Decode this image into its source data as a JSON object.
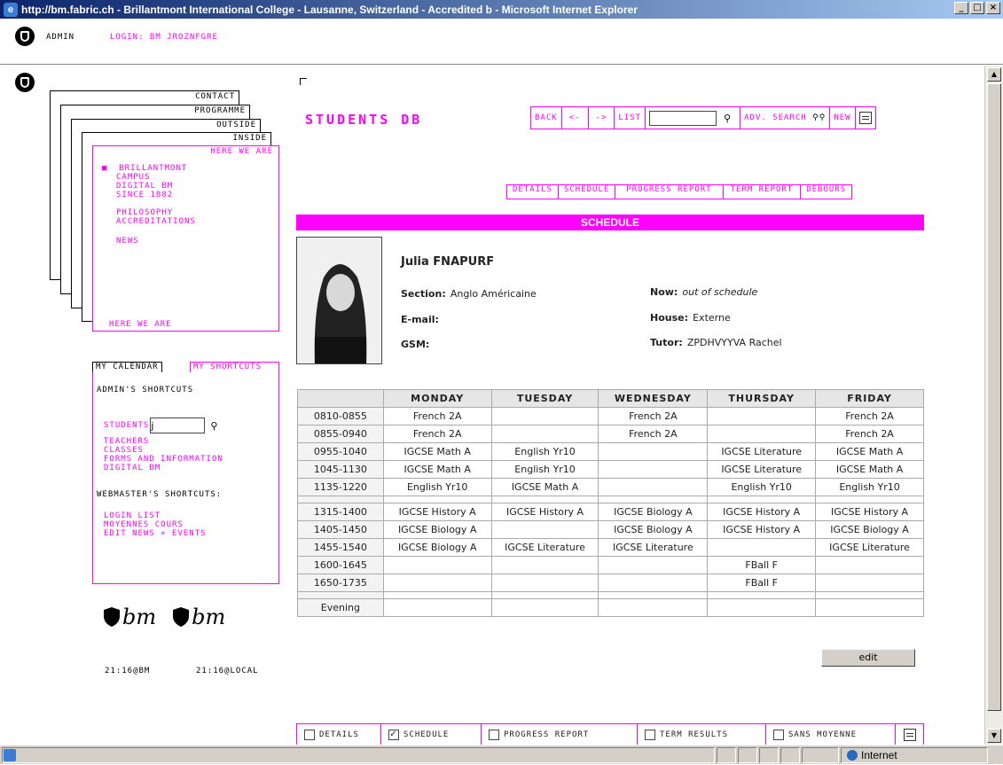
{
  "window": {
    "title": "http://bm.fabric.ch - Brillantmont International College - Lausanne, Switzerland - Accredited b - Microsoft Internet Explorer"
  },
  "topbar": {
    "admin": "ADMIN",
    "login": "LOGIN: BM JROZNFGRE"
  },
  "stack": {
    "tabs": [
      "CONTACT",
      "PROGRAMME",
      "OUTSIDE",
      "INSIDE"
    ],
    "inner_title": "HERE WE ARE",
    "items": [
      "BRILLANTMONT",
      "CAMPUS",
      "DIGITAL BM",
      "SINCE 1882",
      "PHILOSOPHY",
      "ACCREDITATIONS",
      "NEWS"
    ],
    "footer": "HERE WE ARE"
  },
  "shortcuts": {
    "tab_calendar": "MY CALENDAR",
    "tab_shortcuts": "MY SHORTCUTS",
    "admin_title": "ADMIN'S SHORTCUTS",
    "students_label": "STUDENTS",
    "students_value": "j",
    "links": [
      "TEACHERS",
      "CLASSES",
      "FORMS AND INFORMATION",
      "DIGITAL BM"
    ],
    "webmaster_title": "WEBMASTER'S SHORTCUTS:",
    "web_links": [
      "LOGIN LIST",
      "MOYENNES COURS",
      "EDIT NEWS + EVENTS"
    ]
  },
  "clocks": {
    "logo_text": "bm",
    "bm": "21:16@BM",
    "local": "21:16@LOCAL"
  },
  "header": {
    "title": "STUDENTS DB",
    "nav": [
      "BACK",
      "<-",
      "->",
      "LIST"
    ],
    "search_value": "",
    "adv": "ADV. SEARCH",
    "new": "NEW"
  },
  "tabs": [
    "DETAILS",
    "SCHEDULE",
    "PROGRESS REPORT",
    "TERM REPORT",
    "DEBOURS"
  ],
  "section_title": "SCHEDULE",
  "student": {
    "name": "Julia FNAPURF",
    "section_label": "Section:",
    "section": "Anglo Américaine",
    "email_label": "E-mail:",
    "email": "",
    "gsm_label": "GSM:",
    "gsm": "",
    "now_label": "Now:",
    "now": "out of schedule",
    "house_label": "House:",
    "house": "Externe",
    "tutor_label": "Tutor:",
    "tutor": "ZPDHVYYVA Rachel"
  },
  "schedule": {
    "days": [
      "MONDAY",
      "TUESDAY",
      "WEDNESDAY",
      "THURSDAY",
      "FRIDAY"
    ],
    "rows": [
      {
        "time": "0810-0855",
        "cells": [
          "French 2A",
          "",
          "French 2A",
          "",
          "French 2A"
        ]
      },
      {
        "time": "0855-0940",
        "cells": [
          "French 2A",
          "",
          "French 2A",
          "",
          "French 2A"
        ]
      },
      {
        "time": "0955-1040",
        "cells": [
          "IGCSE Math A",
          "English Yr10",
          "",
          "IGCSE Literature",
          "IGCSE Math A"
        ]
      },
      {
        "time": "1045-1130",
        "cells": [
          "IGCSE Math A",
          "English Yr10",
          "",
          "IGCSE Literature",
          "IGCSE Math A"
        ]
      },
      {
        "time": "1135-1220",
        "cells": [
          "English Yr10",
          "IGCSE Math A",
          "",
          "English Yr10",
          "English Yr10"
        ]
      },
      {
        "time": "",
        "cells": [
          "",
          "",
          "",
          "",
          ""
        ]
      },
      {
        "time": "1315-1400",
        "cells": [
          "IGCSE History A",
          "IGCSE History A",
          "IGCSE Biology A",
          "IGCSE History A",
          "IGCSE History A"
        ]
      },
      {
        "time": "1405-1450",
        "cells": [
          "IGCSE Biology A",
          "",
          "IGCSE Biology A",
          "IGCSE History A",
          "IGCSE Biology A"
        ]
      },
      {
        "time": "1455-1540",
        "cells": [
          "IGCSE Biology A",
          "IGCSE Literature",
          "IGCSE Literature",
          "",
          "IGCSE Literature"
        ]
      },
      {
        "time": "1600-1645",
        "cells": [
          "",
          "",
          "",
          "FBall F",
          ""
        ]
      },
      {
        "time": "1650-1735",
        "cells": [
          "",
          "",
          "",
          "FBall F",
          ""
        ]
      },
      {
        "time": "",
        "cells": [
          "",
          "",
          "",
          "",
          ""
        ]
      },
      {
        "time": "Evening",
        "cells": [
          "",
          "",
          "",
          "",
          ""
        ]
      }
    ],
    "edit": "edit"
  },
  "bottom": {
    "items": [
      {
        "label": "DETAILS",
        "checked": false
      },
      {
        "label": "SCHEDULE",
        "checked": true
      },
      {
        "label": "PROGRESS REPORT",
        "checked": false
      },
      {
        "label": "TERM RESULTS",
        "checked": false
      },
      {
        "label": "SANS MOYENNE",
        "checked": false
      }
    ]
  },
  "status": {
    "zone": "Internet"
  }
}
